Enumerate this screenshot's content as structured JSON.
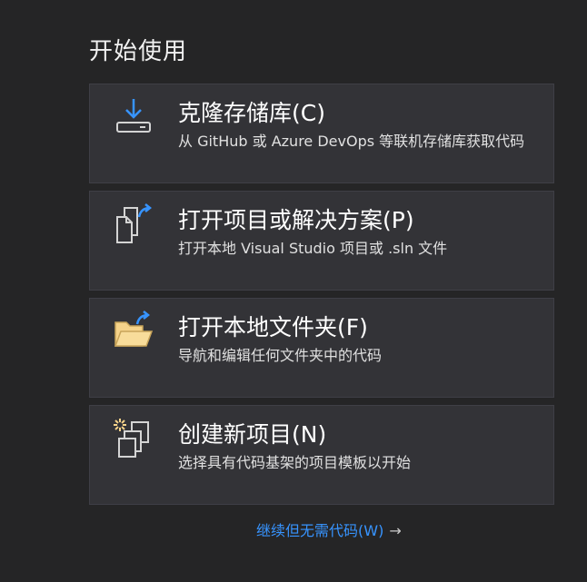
{
  "start": {
    "title": "开始使用",
    "cards": [
      {
        "title": "克隆存储库(C)",
        "description": "从 GitHub 或 Azure DevOps 等联机存储库获取代码",
        "icon": "download-clone-icon"
      },
      {
        "title": "打开项目或解决方案(P)",
        "description": "打开本地 Visual Studio 项目或 .sln 文件",
        "icon": "open-project-icon"
      },
      {
        "title": "打开本地文件夹(F)",
        "description": "导航和编辑任何文件夹中的代码",
        "icon": "open-folder-icon"
      },
      {
        "title": "创建新项目(N)",
        "description": "选择具有代码基架的项目模板以开始",
        "icon": "new-project-icon"
      }
    ],
    "continue_label": "继续但无需代码(W)",
    "continue_arrow": "→"
  },
  "colors": {
    "background": "#252526",
    "card": "#333337",
    "accent_blue": "#3794ff",
    "folder_yellow": "#f5d38a"
  }
}
